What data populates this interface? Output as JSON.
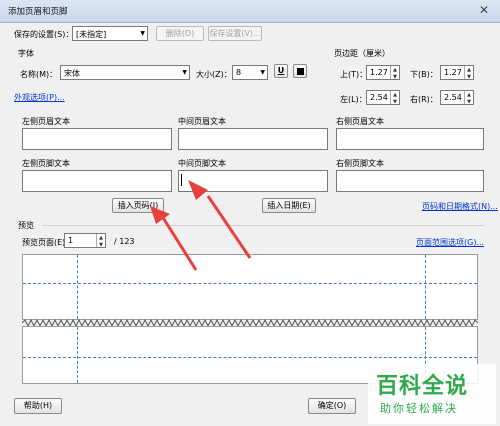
{
  "window": {
    "title": "添加页眉和页脚",
    "close_glyph": "✕"
  },
  "settings": {
    "saved_label": "保存的设置(S)：",
    "saved_value": "[未指定]",
    "delete_label": "删除(D)",
    "save_label": "保存设置(V)..."
  },
  "font": {
    "group_label": "字体",
    "name_label": "名称(M)：",
    "name_value": "宋体",
    "size_label": "大小(Z)：",
    "size_value": "8",
    "underline_glyph": "U"
  },
  "margin": {
    "group_label": "页边距（厘米）",
    "top_label": "上(T)：",
    "top_value": "1.27",
    "bottom_label": "下(B)：",
    "bottom_value": "1.27",
    "left_label": "左(L)：",
    "left_value": "2.54",
    "right_label": "右(R)：",
    "right_value": "2.54"
  },
  "appearance_link": "外观选项(P)...",
  "header_fields": {
    "left_header": "左侧页眉文本",
    "center_header": "中间页眉文本",
    "right_header": "右侧页眉文本",
    "left_footer": "左侧页脚文本",
    "center_footer": "中间页脚文本",
    "right_footer": "右侧页脚文本"
  },
  "insert_page_number": "插入页码(I)",
  "insert_date": "插入日期(E)",
  "page_date_format_link": "页码和日期格式(N)...",
  "preview": {
    "group_label": "预览",
    "page_label": "预览页面(E)",
    "page_value": "1",
    "page_total": "/ 123",
    "page_range_link": "页面范围选项(G)..."
  },
  "footer_buttons": {
    "help": "帮助(H)",
    "ok": "确定(O)"
  },
  "watermark": {
    "main": "百科全说",
    "sub": "助你轻松解决"
  },
  "colors": {
    "arrow": "#e8413c",
    "guide": "#3a7fc9",
    "link": "#0033cc",
    "watermark": "#2eaa4a"
  }
}
